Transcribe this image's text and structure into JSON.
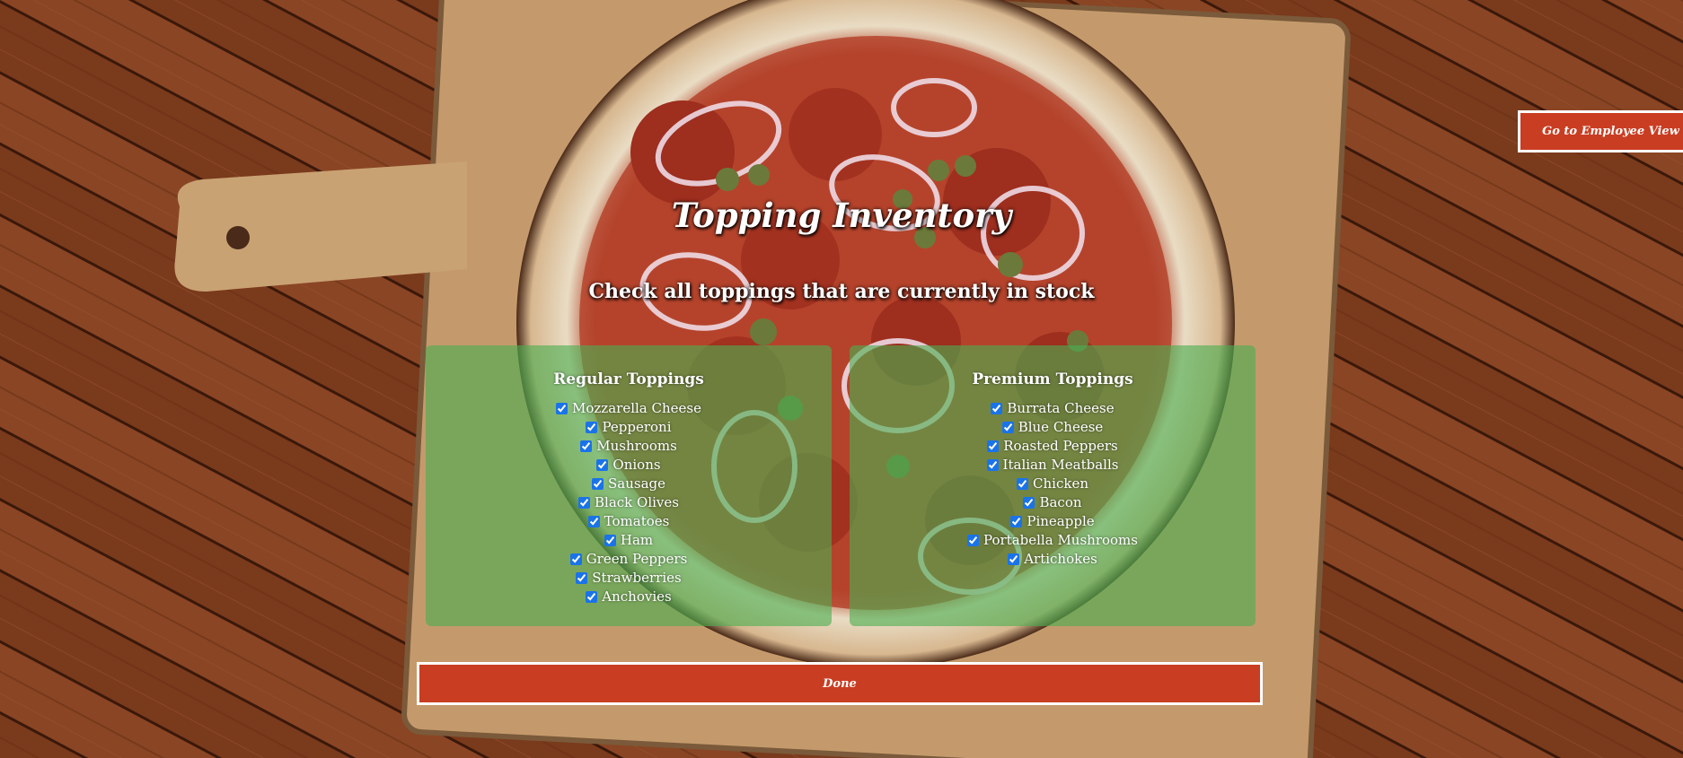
{
  "header": {
    "employee_view_label": "Go to Employee View"
  },
  "page": {
    "title": "Topping Inventory",
    "subtitle": "Check all toppings that are currently in stock"
  },
  "regular": {
    "heading": "Regular Toppings",
    "items": [
      {
        "label": "Mozzarella Cheese",
        "checked": true
      },
      {
        "label": "Pepperoni",
        "checked": true
      },
      {
        "label": "Mushrooms",
        "checked": true
      },
      {
        "label": "Onions",
        "checked": true
      },
      {
        "label": "Sausage",
        "checked": true
      },
      {
        "label": "Black Olives",
        "checked": true
      },
      {
        "label": "Tomatoes",
        "checked": true
      },
      {
        "label": "Ham",
        "checked": true
      },
      {
        "label": "Green Peppers",
        "checked": true
      },
      {
        "label": "Strawberries",
        "checked": true
      },
      {
        "label": "Anchovies",
        "checked": true
      }
    ]
  },
  "premium": {
    "heading": "Premium Toppings",
    "items": [
      {
        "label": "Burrata Cheese",
        "checked": true
      },
      {
        "label": "Blue Cheese",
        "checked": true
      },
      {
        "label": "Roasted Peppers",
        "checked": true
      },
      {
        "label": "Italian Meatballs",
        "checked": true
      },
      {
        "label": "Chicken",
        "checked": true
      },
      {
        "label": "Bacon",
        "checked": true
      },
      {
        "label": "Pineapple",
        "checked": true
      },
      {
        "label": "Portabella Mushrooms",
        "checked": true
      },
      {
        "label": "Artichokes",
        "checked": true
      }
    ]
  },
  "footer": {
    "done_label": "Done"
  },
  "colors": {
    "accent": "#c93d22",
    "panel": "#4caf50",
    "checkbox": "#1a73e8"
  }
}
